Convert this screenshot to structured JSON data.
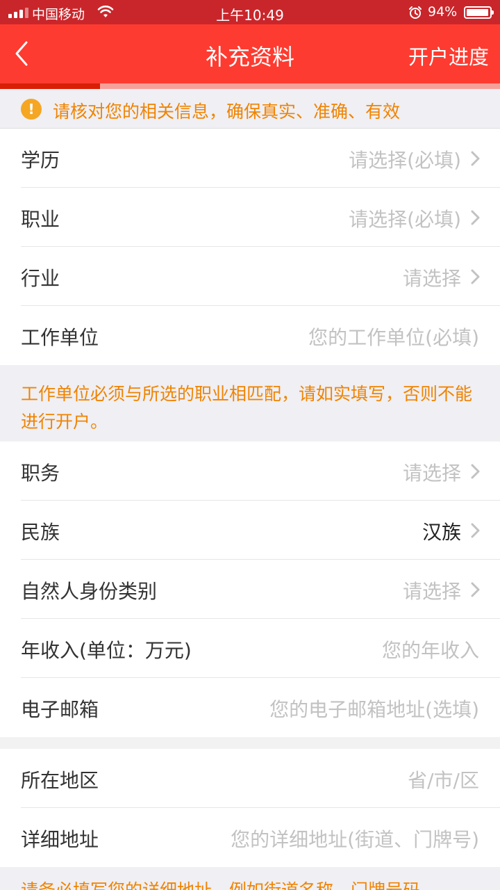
{
  "status_bar": {
    "carrier": "中国移动",
    "time": "上午10:49",
    "battery": "94%",
    "icons": [
      "signal-icon",
      "wifi-icon",
      "alarm-icon",
      "battery-icon"
    ]
  },
  "nav": {
    "title": "补充资料",
    "right_action": "开户进度",
    "back_icon": "chevron-left-icon"
  },
  "progress": {
    "value": 0.2
  },
  "notice": {
    "icon": "warning-icon",
    "text": "请核对您的相关信息，确保真实、准确、有效"
  },
  "form": {
    "education": {
      "label": "学历",
      "value": "请选择(必填)"
    },
    "occupation": {
      "label": "职业",
      "value": "请选择(必填)"
    },
    "industry": {
      "label": "行业",
      "value": "请选择"
    },
    "employer": {
      "label": "工作单位",
      "placeholder": "您的工作单位(必填)"
    },
    "employer_hint": "工作单位必须与所选的职业相匹配，请如实填写，否则不能进行开户。",
    "position": {
      "label": "职务",
      "value": "请选择"
    },
    "ethnicity": {
      "label": "民族",
      "value": "汉族"
    },
    "identity_type": {
      "label": "自然人身份类别",
      "value": "请选择"
    },
    "annual_income": {
      "label": "年收入(单位：万元)",
      "placeholder": "您的年收入"
    },
    "email": {
      "label": "电子邮箱",
      "placeholder": "您的电子邮箱地址(选填)"
    },
    "region": {
      "label": "所在地区",
      "value": "省/市/区"
    },
    "address": {
      "label": "详细地址",
      "placeholder": "您的详细地址(街道、门牌号)"
    },
    "address_hint": "请务必填写您的详细地址，例如街道名称、门牌号码"
  },
  "colors": {
    "status_bar": "#c9262b",
    "nav_bar": "#fe3b30",
    "progress_fill": "#d81e06",
    "progress_track": "#f7a09a",
    "warning_text": "#f08300",
    "placeholder": "#c2c2c2"
  }
}
